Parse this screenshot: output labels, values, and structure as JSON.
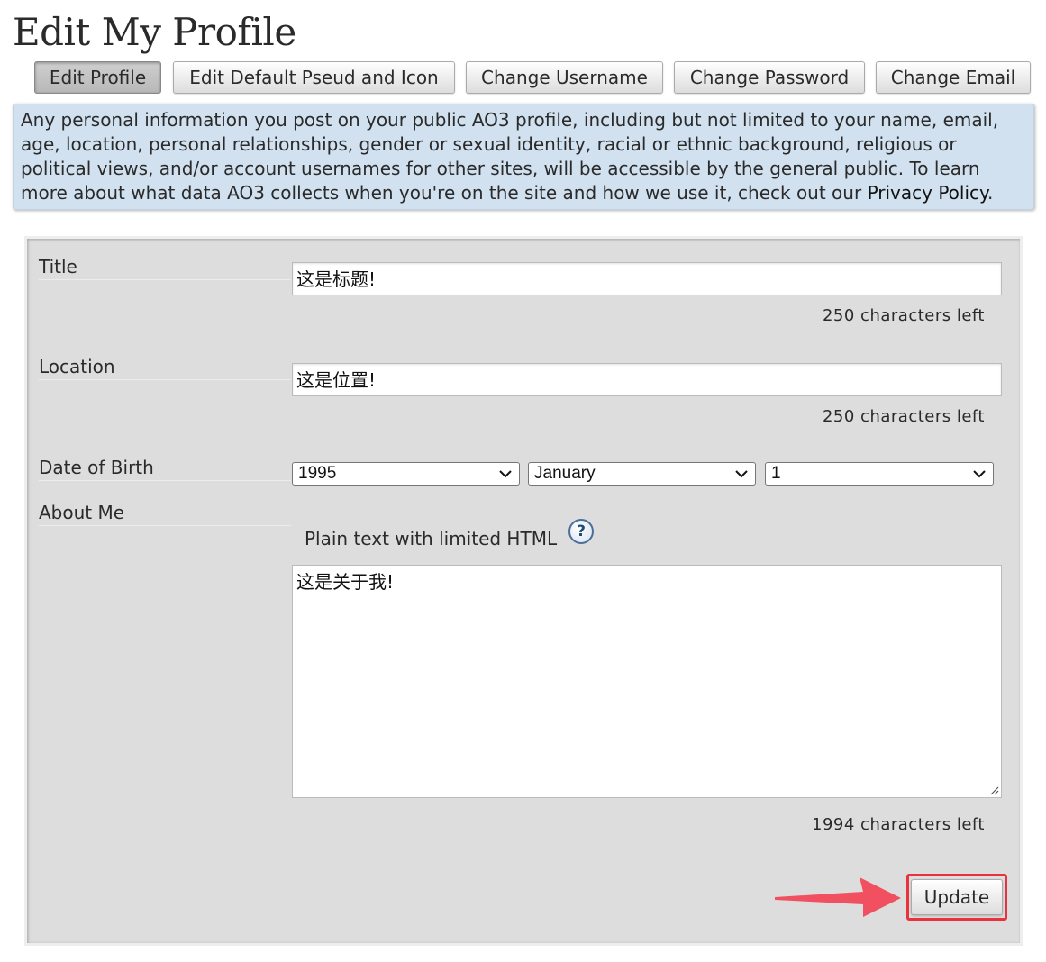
{
  "page": {
    "title": "Edit My Profile"
  },
  "nav": {
    "buttons": [
      {
        "label": "Edit Profile",
        "current": true
      },
      {
        "label": "Edit Default Pseud and Icon",
        "current": false
      },
      {
        "label": "Change Username",
        "current": false
      },
      {
        "label": "Change Password",
        "current": false
      },
      {
        "label": "Change Email",
        "current": false
      }
    ]
  },
  "notice": {
    "text": "Any personal information you post on your public AO3 profile, including but not limited to your name, email, age, location, personal relationships, gender or sexual identity, racial or ethnic background, religious or political views, and/or account usernames for other sites, will be accessible by the general public. To learn more about what data AO3 collects when you're on the site and how we use it, check out our ",
    "link_label": "Privacy Policy",
    "trailing": "."
  },
  "form": {
    "title": {
      "label": "Title",
      "value": "这是标题!",
      "chars_left": "250 characters left"
    },
    "location": {
      "label": "Location",
      "value": "这是位置!",
      "chars_left": "250 characters left"
    },
    "dob": {
      "label": "Date of Birth",
      "year": "1995",
      "month": "January",
      "day": "1"
    },
    "about": {
      "label": "About Me",
      "format_note": "Plain text with limited HTML",
      "help_glyph": "?",
      "value": "这是关于我!",
      "chars_left": "1994 characters left"
    },
    "submit_label": "Update"
  },
  "colors": {
    "notice_bg": "#d1e1ef",
    "panel_bg": "#dddddd",
    "highlight": "#e8333f"
  },
  "icons": {
    "select_chevron": "chevron-down-icon",
    "help": "help-icon",
    "annotation_arrow": "arrow-right-icon"
  }
}
